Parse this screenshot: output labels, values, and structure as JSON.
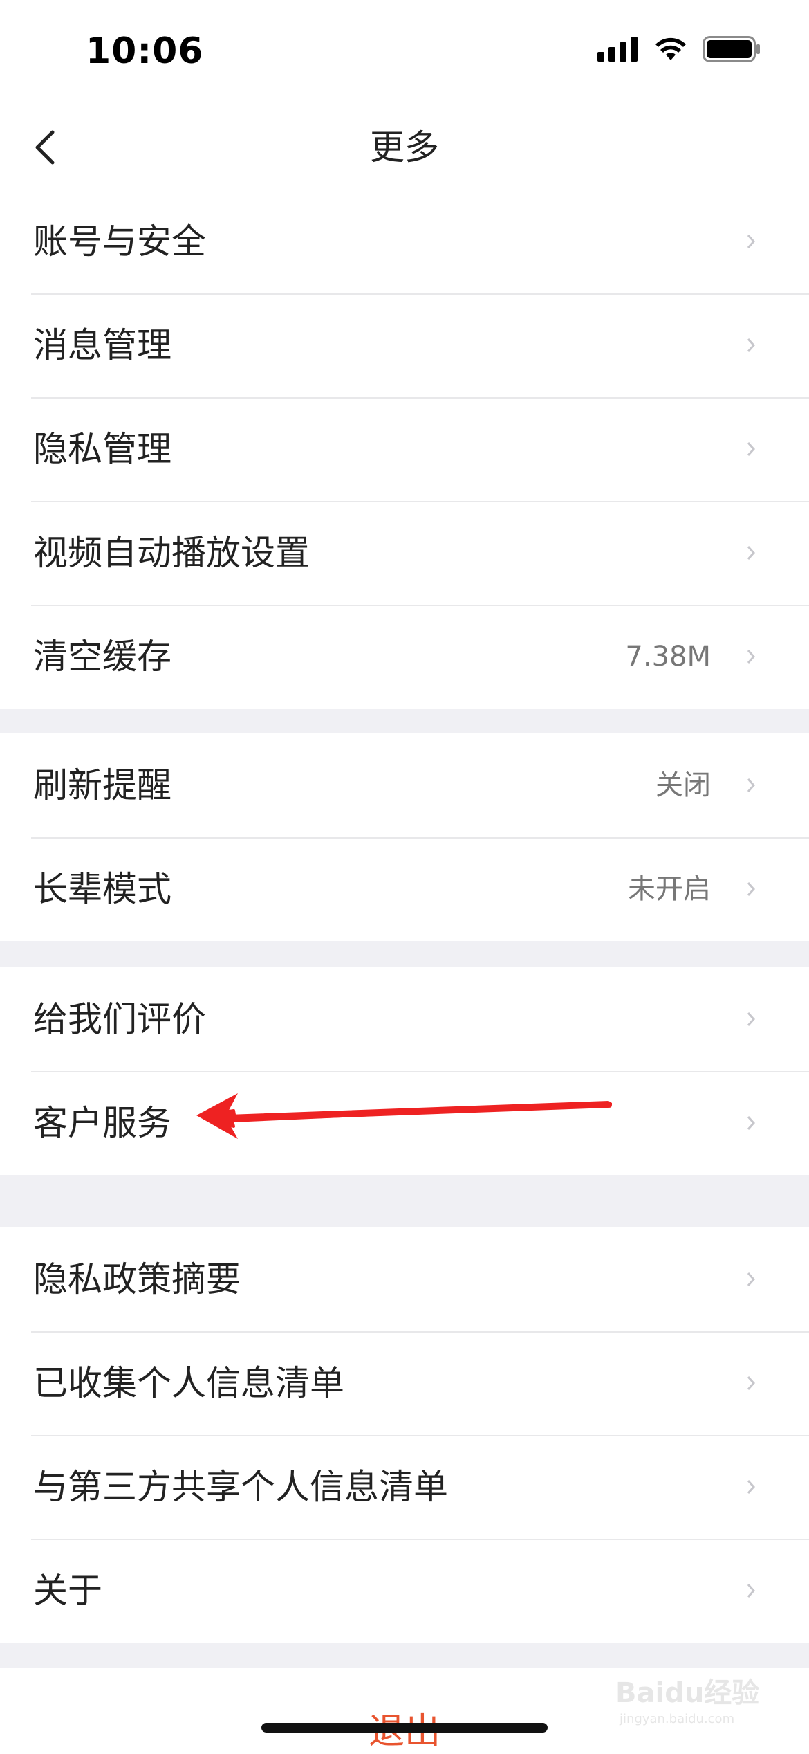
{
  "status_bar": {
    "time": "10:06"
  },
  "nav": {
    "title": "更多"
  },
  "sections": [
    {
      "items": [
        {
          "label": "账号与安全",
          "value": ""
        },
        {
          "label": "消息管理",
          "value": ""
        },
        {
          "label": "隐私管理",
          "value": ""
        },
        {
          "label": "视频自动播放设置",
          "value": ""
        },
        {
          "label": "清空缓存",
          "value": "7.38M"
        }
      ]
    },
    {
      "items": [
        {
          "label": "刷新提醒",
          "value": "关闭"
        },
        {
          "label": "长辈模式",
          "value": "未开启"
        }
      ]
    },
    {
      "items": [
        {
          "label": "给我们评价",
          "value": ""
        },
        {
          "label": "客户服务",
          "value": ""
        }
      ]
    },
    {
      "items": [
        {
          "label": "隐私政策摘要",
          "value": ""
        },
        {
          "label": "已收集个人信息清单",
          "value": ""
        },
        {
          "label": "与第三方共享个人信息清单",
          "value": ""
        },
        {
          "label": "关于",
          "value": ""
        }
      ]
    }
  ],
  "logout": {
    "label": "退出"
  },
  "watermark": {
    "text": "Baidu经验",
    "sub": "jingyan.baidu.com"
  },
  "icons": {
    "back": "chevron-left-icon",
    "row": "chevron-right-icon",
    "signal": "cellular-signal-icon",
    "wifi": "wifi-icon",
    "battery": "battery-icon"
  },
  "colors": {
    "accent": "#e8542f",
    "annotation_arrow": "#ee2222",
    "separator_bg": "#f0f0f4"
  }
}
